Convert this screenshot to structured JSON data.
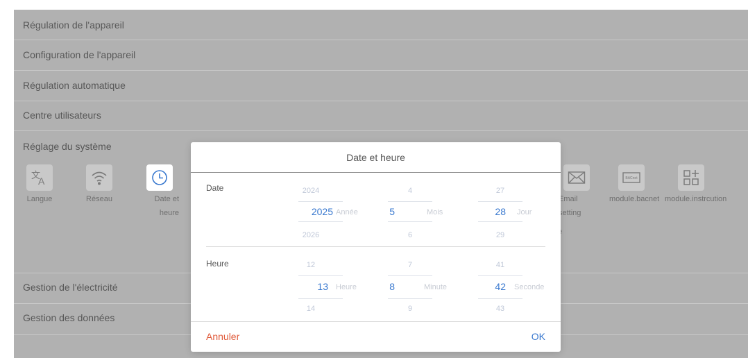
{
  "menu": {
    "items": [
      "Régulation de l'appareil",
      "Configuration de l'appareil",
      "Régulation automatique",
      "Centre utilisateurs",
      "Réglage du système",
      "Gestion de l'électricité",
      "Gestion des données"
    ]
  },
  "system_tiles": [
    {
      "label": "Langue",
      "icon": "translate-icon"
    },
    {
      "label": "Réseau",
      "icon": "wifi-icon"
    },
    {
      "label": "Date et heure",
      "icon": "clock-icon",
      "active": true
    },
    {
      "label": "Email setting",
      "icon": "envelope-icon"
    },
    {
      "label": "module.bacnet",
      "icon": "bacnet-icon",
      "icon_text": "BACnet"
    },
    {
      "label": "module.instrcution",
      "icon": "grid-plus-icon"
    }
  ],
  "hidden_fragment": "e",
  "dialog": {
    "title": "Date et heure",
    "date_label": "Date",
    "time_label": "Heure",
    "date": {
      "year": {
        "prev": "2024",
        "current": "2025",
        "next": "2026",
        "unit": "Année"
      },
      "month": {
        "prev": "4",
        "current": "5",
        "next": "6",
        "unit": "Mois"
      },
      "day": {
        "prev": "27",
        "current": "28",
        "next": "29",
        "unit": "Jour"
      }
    },
    "time": {
      "hour": {
        "prev": "12",
        "current": "13",
        "next": "14",
        "unit": "Heure"
      },
      "minute": {
        "prev": "7",
        "current": "8",
        "next": "9",
        "unit": "Minute"
      },
      "second": {
        "prev": "41",
        "current": "42",
        "next": "43",
        "unit": "Seconde"
      }
    },
    "cancel_label": "Annuler",
    "ok_label": "OK"
  },
  "colors": {
    "accent": "#3a79cf",
    "cancel": "#e05a3a",
    "overlay": "#b1b1b1"
  }
}
